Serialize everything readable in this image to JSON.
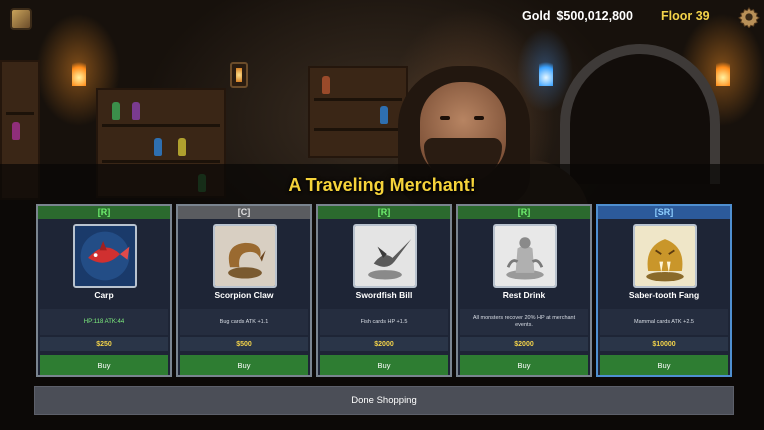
{
  "hud": {
    "gold_label": "Gold",
    "gold_value": "$500,012,800",
    "floor": "Floor 39",
    "menu_icon": "inventory-icon",
    "settings_icon": "gear-icon"
  },
  "colors": {
    "gold_text": "#f3d34a",
    "buy_button": "#2e7d32",
    "rarity_r": "#2b6a2e",
    "rarity_c": "#5a5c60",
    "rarity_sr": "#2c5a9a"
  },
  "shop": {
    "title": "A Traveling Merchant!",
    "items": [
      {
        "rarity": "[R]",
        "name": "Carp",
        "effect": "HP:118  ATK:44",
        "price": "$250",
        "buy": "Buy",
        "icon": "carp-icon"
      },
      {
        "rarity": "[C]",
        "name": "Scorpion Claw",
        "effect": "Bug cards ATK +1.1",
        "price": "$500",
        "buy": "Buy",
        "icon": "scorpion-claw-icon"
      },
      {
        "rarity": "[R]",
        "name": "Swordfish Bill",
        "effect": "Fish cards HP +1.5",
        "price": "$2000",
        "buy": "Buy",
        "icon": "swordfish-bill-icon"
      },
      {
        "rarity": "[R]",
        "name": "Rest Drink",
        "effect": "All monsters recover 20% HP at merchant events.",
        "price": "$2000",
        "buy": "Buy",
        "icon": "rest-drink-icon"
      },
      {
        "rarity": "[SR]",
        "name": "Saber-tooth Fang",
        "effect": "Mammal cards ATK +2.5",
        "price": "$10000",
        "buy": "Buy",
        "icon": "saber-tooth-fang-icon"
      }
    ],
    "done_label": "Done Shopping"
  }
}
